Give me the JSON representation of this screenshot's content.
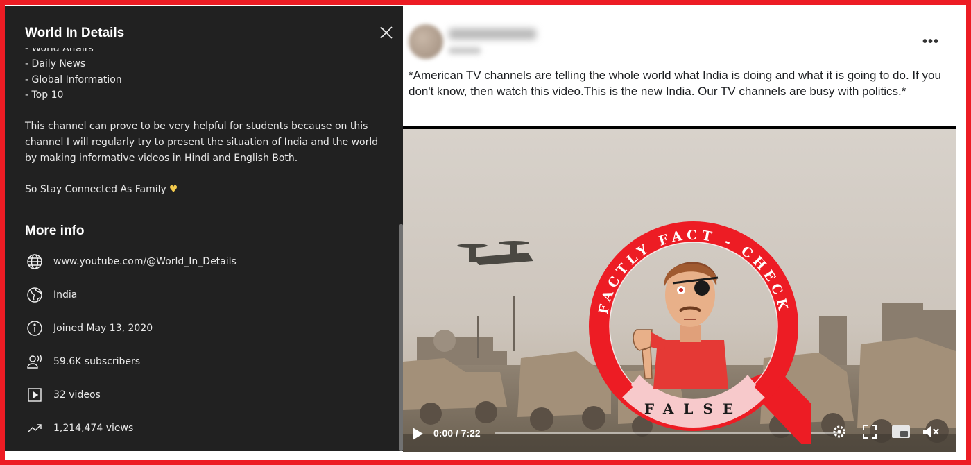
{
  "about": {
    "title": "World In Details",
    "description_partial_line": "- World Affairs",
    "description_items": [
      "- Daily News",
      "- Global Information",
      "- Top 10"
    ],
    "description_paragraph": "This channel can prove to be very helpful for students because on this channel I will regularly try to present the situation of India and the world by making informative videos in Hindi and English Both.",
    "sign_off": "So Stay Connected As Family",
    "more_info_title": "More info",
    "info": {
      "url": "www.youtube.com/@World_In_Details",
      "country": "India",
      "joined": "Joined May 13, 2020",
      "subscribers": "59.6K subscribers",
      "videos": "32 videos",
      "views": "1,214,474 views"
    }
  },
  "post": {
    "menu_label": "•••",
    "text": "*American TV channels are telling the whole world what India is doing and what it is going to do. If you don't know, then watch this video.This is the new India. Our TV channels are busy with politics.*",
    "video": {
      "time": "0:00 / 7:22",
      "progress": 0.0
    }
  },
  "badge": {
    "top_text": "FACTLY FACT - CHECK",
    "verdict": "FALSE"
  },
  "colors": {
    "brand_red": "#ed1c24",
    "panel_bg": "#212121"
  }
}
